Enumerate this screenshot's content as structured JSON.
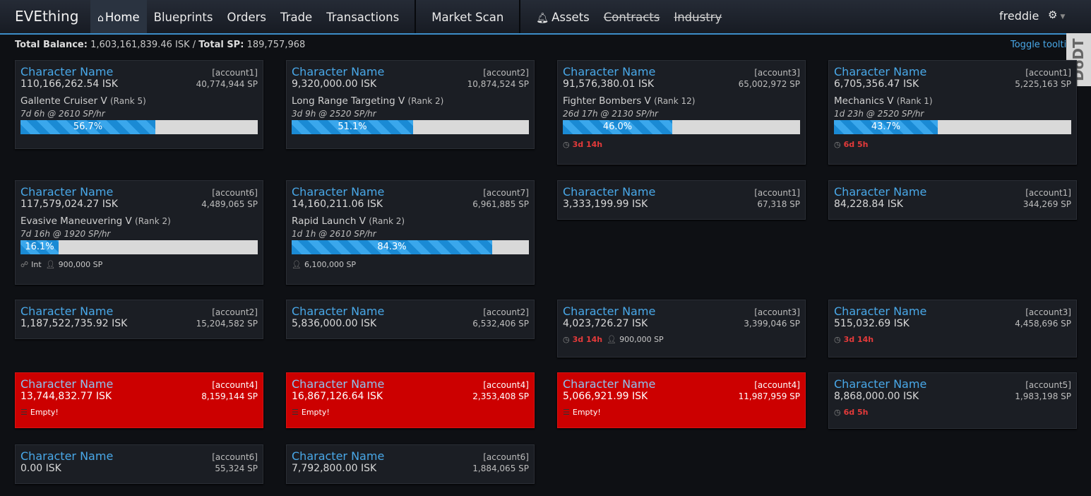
{
  "nav": {
    "brand": "EVEthing",
    "items": [
      {
        "label": "Home",
        "icon": "home-icon",
        "active": true
      },
      {
        "label": "Blueprints"
      },
      {
        "label": "Orders"
      },
      {
        "label": "Trade"
      },
      {
        "label": "Transactions"
      },
      {
        "label": "Market Scan"
      },
      {
        "label": "Assets",
        "icon": "bell-icon"
      },
      {
        "label": "Contracts",
        "struck": true
      },
      {
        "label": "Industry",
        "struck": true
      }
    ],
    "user": "freddie",
    "settings_icon": "gear-icon"
  },
  "summary": {
    "balance_label": "Total Balance:",
    "balance_value": "1,603,161,839.46 ISK",
    "separator": "/",
    "sp_label": "Total SP:",
    "sp_value": "189,757,968",
    "toggle_label": "Toggle tooltips"
  },
  "overlay_badge": "DoDT",
  "characters": [
    {
      "name": "Character Name",
      "account": "[account1]",
      "isk": "110,166,262.54 ISK",
      "sp": "40,774,944 SP",
      "skill": "Gallente Cruiser V",
      "rank": "(Rank 5)",
      "eta": "7d 6h @ 2610 SP/hr",
      "progress_pct": "56.7%",
      "progress": 0.567,
      "extras": []
    },
    {
      "name": "Character Name",
      "account": "[account2]",
      "isk": "9,320,000.00 ISK",
      "sp": "10,874,524 SP",
      "skill": "Long Range Targeting V",
      "rank": "(Rank 2)",
      "eta": "3d 9h @ 2520 SP/hr",
      "progress_pct": "51.1%",
      "progress": 0.511,
      "extras": []
    },
    {
      "name": "Character Name",
      "account": "[account3]",
      "isk": "91,576,380.01 ISK",
      "sp": "65,002,972 SP",
      "skill": "Fighter Bombers V",
      "rank": "(Rank 12)",
      "eta": "26d 17h @ 2130 SP/hr",
      "progress_pct": "46.0%",
      "progress": 0.46,
      "extras": [
        {
          "icon": "clock-icon",
          "text": "3d 14h",
          "timer": true
        }
      ]
    },
    {
      "name": "Character Name",
      "account": "[account1]",
      "isk": "6,705,356.47 ISK",
      "sp": "5,225,163 SP",
      "skill": "Mechanics V",
      "rank": "(Rank 1)",
      "eta": "1d 23h @ 2520 SP/hr",
      "progress_pct": "43.7%",
      "progress": 0.437,
      "extras": [
        {
          "icon": "clock-icon",
          "text": "6d 5h",
          "timer": true
        }
      ]
    },
    {
      "name": "Character Name",
      "account": "[account6]",
      "isk": "117,579,024.27 ISK",
      "sp": "4,489,065 SP",
      "skill": "Evasive Maneuvering V",
      "rank": "(Rank 2)",
      "eta": "7d 16h @ 1920 SP/hr",
      "progress_pct": "16.1%",
      "progress": 0.161,
      "extras": [
        {
          "icon": "implant-icon",
          "text": "Int"
        },
        {
          "icon": "user-icon",
          "text": "900,000 SP"
        }
      ]
    },
    {
      "name": "Character Name",
      "account": "[account7]",
      "isk": "14,160,211.06 ISK",
      "sp": "6,961,885 SP",
      "skill": "Rapid Launch V",
      "rank": "(Rank 2)",
      "eta": "1d 1h @ 2610 SP/hr",
      "progress_pct": "84.3%",
      "progress": 0.843,
      "extras": [
        {
          "icon": "user-icon",
          "text": "6,100,000 SP"
        }
      ]
    },
    {
      "name": "Character Name",
      "account": "[account1]",
      "isk": "3,333,199.99 ISK",
      "sp": "67,318 SP",
      "extras": []
    },
    {
      "name": "Character Name",
      "account": "[account1]",
      "isk": "84,228.84 ISK",
      "sp": "344,269 SP",
      "extras": []
    },
    {
      "name": "Character Name",
      "account": "[account2]",
      "isk": "1,187,522,735.92 ISK",
      "sp": "15,204,582 SP",
      "extras": []
    },
    {
      "name": "Character Name",
      "account": "[account2]",
      "isk": "5,836,000.00 ISK",
      "sp": "6,532,406 SP",
      "extras": []
    },
    {
      "name": "Character Name",
      "account": "[account3]",
      "isk": "4,023,726.27 ISK",
      "sp": "3,399,046 SP",
      "extras": [
        {
          "icon": "clock-icon",
          "text": "3d 14h",
          "timer": true
        },
        {
          "icon": "user-icon",
          "text": "900,000 SP"
        }
      ]
    },
    {
      "name": "Character Name",
      "account": "[account3]",
      "isk": "515,032.69 ISK",
      "sp": "4,458,696 SP",
      "extras": [
        {
          "icon": "clock-icon",
          "text": "3d 14h",
          "timer": true
        }
      ]
    },
    {
      "name": "Character Name",
      "account": "[account4]",
      "isk": "13,744,832.77 ISK",
      "sp": "8,159,144 SP",
      "alert": true,
      "extras": [
        {
          "icon": "queue-icon",
          "text": "Empty!"
        }
      ]
    },
    {
      "name": "Character Name",
      "account": "[account4]",
      "isk": "16,867,126.64 ISK",
      "sp": "2,353,408 SP",
      "alert": true,
      "extras": [
        {
          "icon": "queue-icon",
          "text": "Empty!"
        }
      ]
    },
    {
      "name": "Character Name",
      "account": "[account4]",
      "isk": "5,066,921.99 ISK",
      "sp": "11,987,959 SP",
      "alert": true,
      "extras": [
        {
          "icon": "queue-icon",
          "text": "Empty!"
        }
      ]
    },
    {
      "name": "Character Name",
      "account": "[account5]",
      "isk": "8,868,000.00 ISK",
      "sp": "1,983,198 SP",
      "extras": [
        {
          "icon": "clock-icon",
          "text": "6d 5h",
          "timer": true
        }
      ]
    },
    {
      "name": "Character Name",
      "account": "[account6]",
      "isk": "0.00 ISK",
      "sp": "55,324 SP",
      "extras": []
    },
    {
      "name": "Character Name",
      "account": "[account6]",
      "isk": "7,792,800.00 ISK",
      "sp": "1,884,065 SP",
      "extras": []
    }
  ]
}
